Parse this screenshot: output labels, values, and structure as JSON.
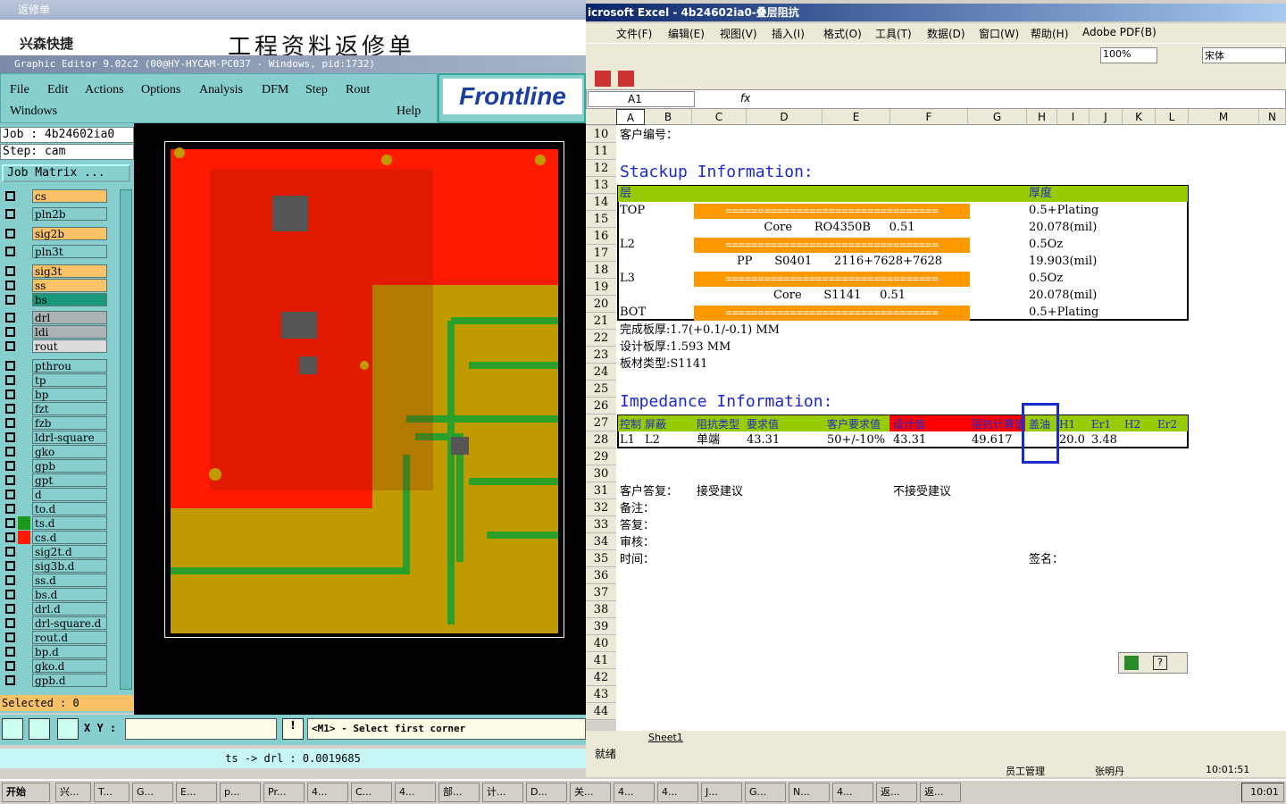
{
  "bgdoc": {
    "title": "返修单",
    "logo": "兴森快捷",
    "heading": "工程资料返修单"
  },
  "ge": {
    "title": "Graphic Editor 9.02c2 (00@HY-HYCAM-PC037 - Windows, pid:1732)",
    "menu": [
      "File",
      "Edit",
      "Actions",
      "Options",
      "Analysis",
      "DFM",
      "Step",
      "Rout",
      "Windows",
      "Help"
    ],
    "brand": "Frontline",
    "job": "Job : 4b24602ia0",
    "step": "Step: cam",
    "job_matrix": "Job Matrix ...",
    "selected": "Selected : 0",
    "xy_label": "X Y :",
    "message": "<M1> - Select first corner",
    "status": "ts -> drl : 0.0019685",
    "layers": [
      {
        "name": "cs",
        "color": "#f9c266"
      },
      {
        "name": "pln2b",
        "color": "#87cfcf"
      },
      {
        "name": "sig2b",
        "color": "#f9c266"
      },
      {
        "name": "pln3t",
        "color": "#87cfcf"
      },
      {
        "name": "sig3t",
        "color": "#f9c266"
      },
      {
        "name": "ss",
        "color": "#f9c266"
      },
      {
        "name": "bs",
        "color": "#1a9a7a"
      },
      {
        "name": "drl",
        "color": "#aab4b4"
      },
      {
        "name": "ldi",
        "color": "#aab4b4"
      },
      {
        "name": "rout",
        "color": "#dcdcdc"
      },
      {
        "name": "pthrou",
        "color": "#87cfcf"
      },
      {
        "name": "tp",
        "color": "#87cfcf"
      },
      {
        "name": "bp",
        "color": "#87cfcf"
      },
      {
        "name": "fzt",
        "color": "#87cfcf"
      },
      {
        "name": "fzb",
        "color": "#87cfcf"
      },
      {
        "name": "ldrl-square",
        "color": "#87cfcf"
      },
      {
        "name": "gko",
        "color": "#87cfcf"
      },
      {
        "name": "gpb",
        "color": "#87cfcf"
      },
      {
        "name": "gpt",
        "color": "#87cfcf"
      },
      {
        "name": "d",
        "color": "#87cfcf"
      },
      {
        "name": "to.d",
        "color": "#87cfcf"
      },
      {
        "name": "ts.d",
        "color": "#87cfcf"
      },
      {
        "name": "cs.d",
        "color": "#87cfcf"
      },
      {
        "name": "sig2t.d",
        "color": "#87cfcf"
      },
      {
        "name": "sig3b.d",
        "color": "#87cfcf"
      },
      {
        "name": "ss.d",
        "color": "#87cfcf"
      },
      {
        "name": "bs.d",
        "color": "#87cfcf"
      },
      {
        "name": "drl.d",
        "color": "#87cfcf"
      },
      {
        "name": "drl-square.d",
        "color": "#87cfcf"
      },
      {
        "name": "rout.d",
        "color": "#87cfcf"
      },
      {
        "name": "bp.d",
        "color": "#87cfcf"
      },
      {
        "name": "gko.d",
        "color": "#87cfcf"
      },
      {
        "name": "gpb.d",
        "color": "#87cfcf"
      }
    ]
  },
  "xl": {
    "title": "icrosoft Excel - 4b24602ia0-叠层阻抗",
    "menu": [
      "文件(F)",
      "编辑(E)",
      "视图(V)",
      "插入(I)",
      "格式(O)",
      "工具(T)",
      "数据(D)",
      "窗口(W)",
      "帮助(H)",
      "Adobe PDF(B)"
    ],
    "zoom": "100%",
    "font": "宋体",
    "namebox": "A1",
    "fx": "fx",
    "columns": [
      "A",
      "B",
      "C",
      "D",
      "E",
      "F",
      "G",
      "H",
      "I",
      "J",
      "K",
      "L",
      "M",
      "N"
    ],
    "rows": [
      "10",
      "11",
      "12",
      "13",
      "14",
      "15",
      "16",
      "17",
      "18",
      "19",
      "20",
      "21",
      "22",
      "23",
      "24",
      "25",
      "26",
      "27",
      "28",
      "29",
      "30",
      "31",
      "32",
      "33",
      "34",
      "35",
      "36",
      "37",
      "38",
      "39",
      "40",
      "41",
      "42",
      "43",
      "44"
    ],
    "r10": "客户编号：",
    "stackup_title": "Stackup Information:",
    "hdr_layer": "层",
    "hdr_thick": "厚度",
    "bar": "=================================",
    "stack": [
      {
        "row": "14",
        "layer": "TOP",
        "thick": "0.5+Plating"
      },
      {
        "row": "15",
        "mid": "Core      RO4350B     0.51",
        "thick": "20.078(mil)"
      },
      {
        "row": "16",
        "layer": "L2",
        "thick": "0.5Oz"
      },
      {
        "row": "17",
        "mid": "PP      S0401      2116+7628+7628",
        "thick": "19.903(mil)"
      },
      {
        "row": "18",
        "layer": "L3",
        "thick": "0.5Oz"
      },
      {
        "row": "19",
        "mid": "Core      S1141     0.51",
        "thick": "20.078(mil)"
      },
      {
        "row": "20",
        "layer": "BOT",
        "thick": "0.5+Plating"
      }
    ],
    "r21": "完成板厚:1.7(+0.1/-0.1) MM",
    "r22": "设计板厚:1.593 MM",
    "r23": "板材类型:S1141",
    "imp_title": "Impedance Information:",
    "imp_hdr": [
      "控制",
      "屏蔽",
      "阻抗类型",
      "要求值",
      "客户要求值",
      "设计值",
      "阻抗计算值",
      "盖油",
      "H1",
      "Er1",
      "H2",
      "Er2"
    ],
    "imp_row": [
      "L1",
      "L2",
      "单端",
      "43.31",
      "50+/-10%",
      "43.31",
      "49.617",
      "",
      "20.0",
      "3.48"
    ],
    "r30": "客户答复：",
    "r30b": "接受建议",
    "r30c": "不接受建议",
    "r31": "备注：",
    "r32": "答复：",
    "r33": "审核：",
    "r34": "时间：",
    "r34b": "签名：",
    "sheet": "Sheet1",
    "status": "就绪",
    "status2a": "员工管理",
    "status2b": "张明丹",
    "status2c": "10:01:51"
  },
  "taskbar": {
    "start": "开始",
    "clock": "10:01",
    "items": [
      "兴...",
      "T...",
      "G...",
      "E...",
      "p...",
      "Pr...",
      "4...",
      "C...",
      "4...",
      "部...",
      "计...",
      "D...",
      "关...",
      "4...",
      "4...",
      "J...",
      "G...",
      "N...",
      "4...",
      "返...",
      "返..."
    ]
  }
}
